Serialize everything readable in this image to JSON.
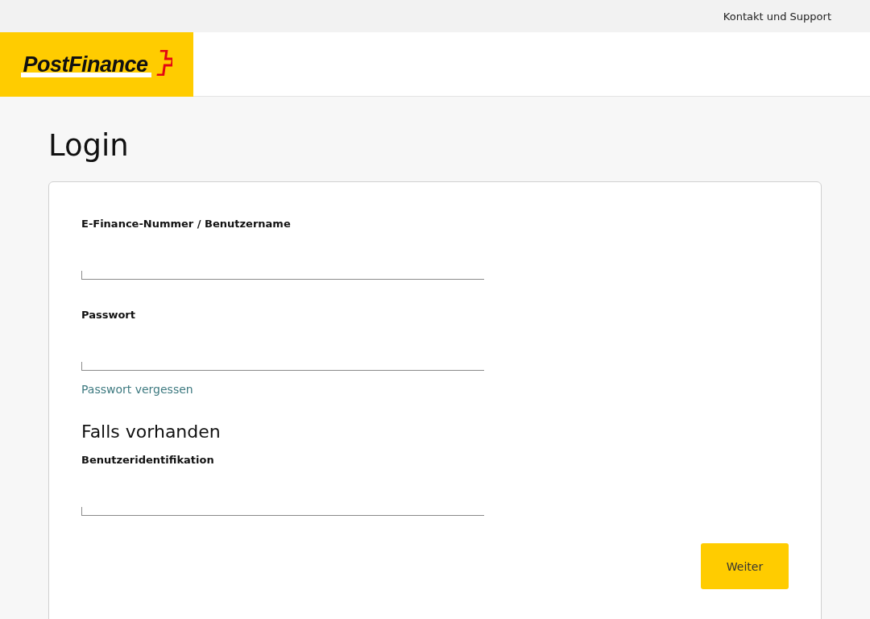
{
  "top_bar": {
    "link": "Kontakt und Support"
  },
  "logo": {
    "text": "PostFinance"
  },
  "title": "Login",
  "form": {
    "items": [
      {
        "kind": "text_field",
        "label": "E-Finance-Nummer / Benutzername"
      },
      {
        "kind": "password_field",
        "label": "Passwort"
      },
      {
        "kind": "link",
        "text": "Passwort vergessen"
      },
      {
        "kind": "heading",
        "text": "Falls vorhanden"
      },
      {
        "kind": "text_field",
        "label": "Benutzeridentifikation"
      }
    ],
    "button": "Weiter"
  }
}
